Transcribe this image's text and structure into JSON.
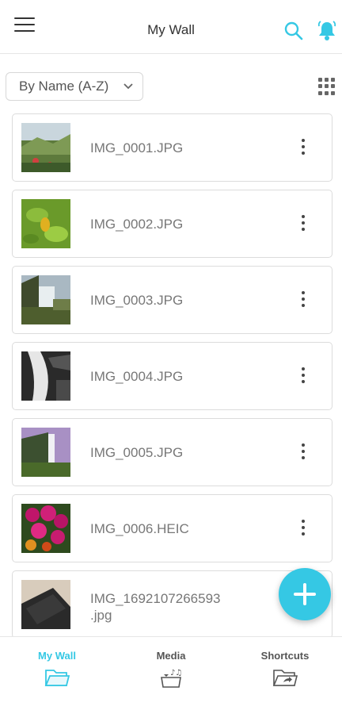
{
  "header": {
    "title": "My Wall",
    "menu_icon": "hamburger-menu-icon",
    "search_icon": "search-icon",
    "notification_icon": "bell-icon",
    "accent_color": "#35c8e4"
  },
  "toolbar": {
    "sort_value": "By Name (A-Z)",
    "view_toggle_icon": "grid-icon"
  },
  "files": [
    {
      "name": "IMG_0001.JPG"
    },
    {
      "name": "IMG_0002.JPG"
    },
    {
      "name": "IMG_0003.JPG"
    },
    {
      "name": "IMG_0004.JPG"
    },
    {
      "name": "IMG_0005.JPG"
    },
    {
      "name": "IMG_0006.HEIC"
    },
    {
      "name_line1": "IMG_1692107266593",
      "name_line2": ".jpg"
    }
  ],
  "fab": {
    "icon": "plus-icon"
  },
  "bottom_nav": {
    "items": [
      {
        "label": "My Wall",
        "icon": "folder-icon",
        "active": true
      },
      {
        "label": "Media",
        "icon": "media-icon",
        "active": false
      },
      {
        "label": "Shortcuts",
        "icon": "shortcut-folder-icon",
        "active": false
      }
    ]
  }
}
